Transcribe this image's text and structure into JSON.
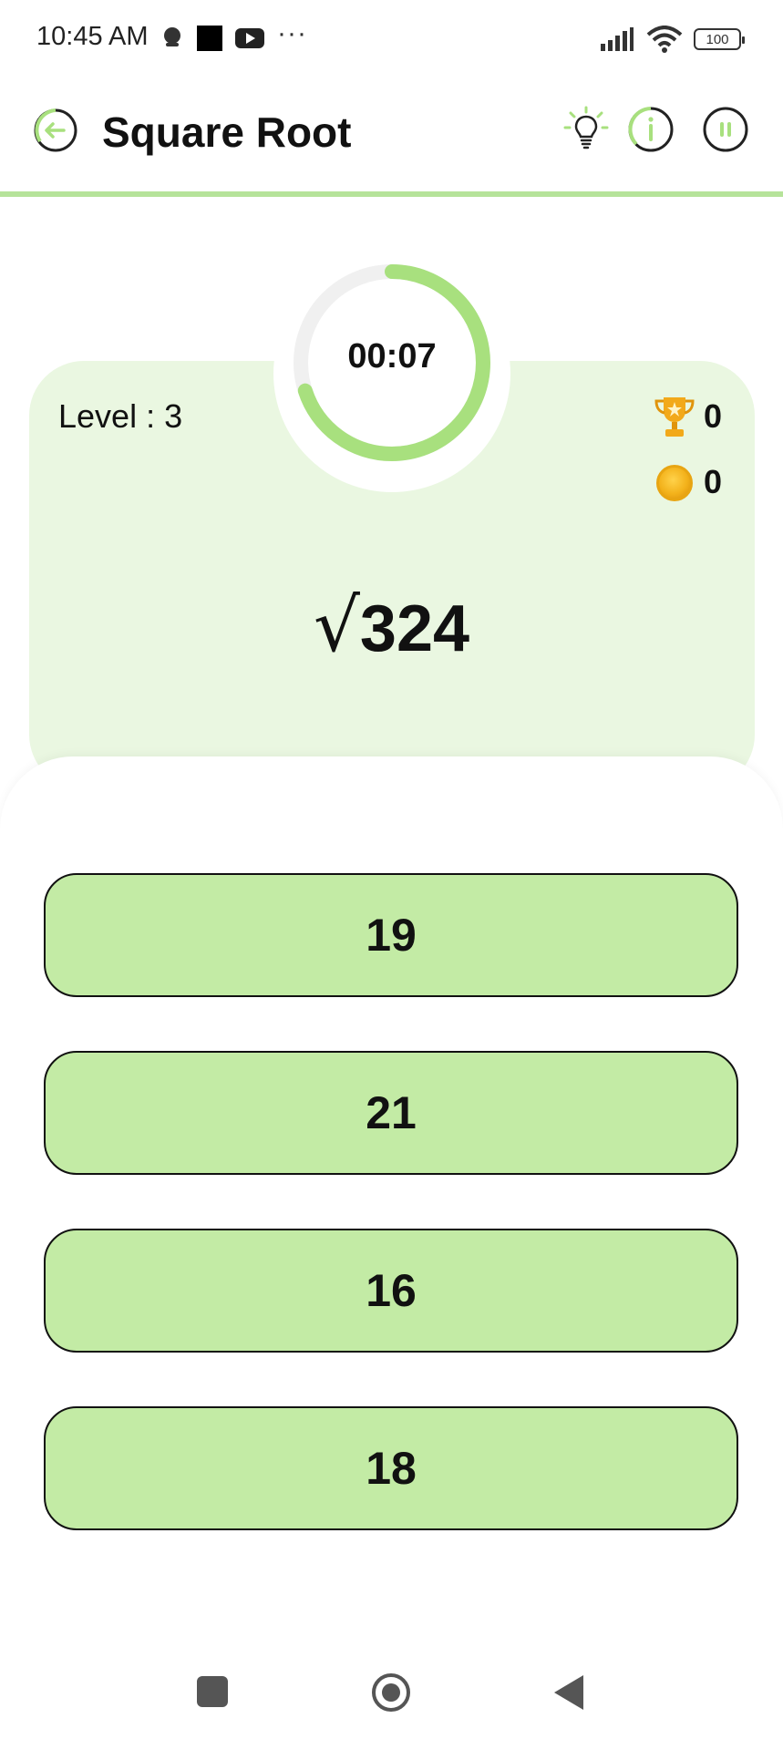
{
  "status_bar": {
    "time": "10:45 AM",
    "battery": "100",
    "icons": [
      "notification-icon",
      "square-icon",
      "youtube-icon",
      "more-dots-icon",
      "signal-icon",
      "wifi-icon",
      "battery-icon"
    ]
  },
  "header": {
    "title": "Square Root",
    "icons": [
      "back-arrow-icon",
      "lightbulb-icon",
      "info-icon",
      "pause-icon"
    ]
  },
  "timer": {
    "text": "00:07",
    "progress": 0.7
  },
  "stats": {
    "level_text": "Level : 3",
    "trophies": "0",
    "coins": "0"
  },
  "question": {
    "symbol": "√",
    "number": "324"
  },
  "answers": [
    {
      "label": "19"
    },
    {
      "label": "21"
    },
    {
      "label": "16"
    },
    {
      "label": "18"
    }
  ],
  "colors": {
    "accent": "#a8e07e",
    "card_bg": "#eaf7e1",
    "answer_bg": "#c3eba5",
    "header_line": "#b6e39a"
  },
  "nav_bar": {
    "icons": [
      "recents-icon",
      "home-icon",
      "back-icon"
    ]
  }
}
